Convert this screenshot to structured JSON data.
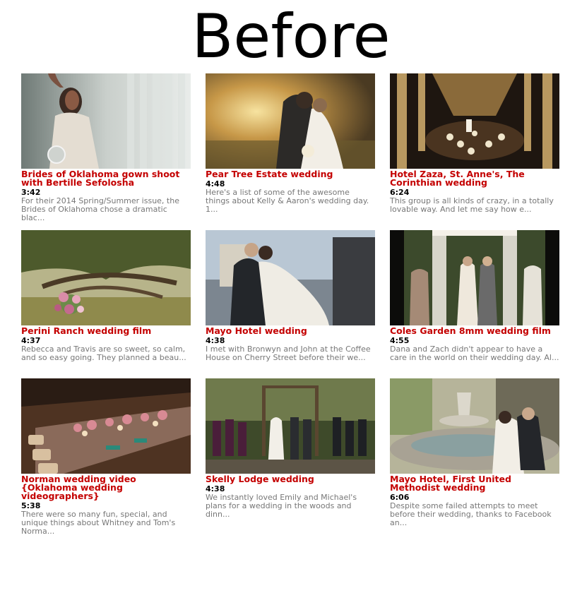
{
  "heading": "Before",
  "videos": [
    {
      "title": "Brides of Oklahoma gown shoot with Bertille Sefolosha",
      "duration": "3:42",
      "description": "For their 2014 Spring/Summer issue, the Brides of Oklahoma chose a dramatic blac..."
    },
    {
      "title": "Pear Tree Estate wedding",
      "duration": "4:48",
      "description": "Here's a list of some of the awesome things about Kelly & Aaron's wedding day. 1..."
    },
    {
      "title": "Hotel Zaza, St. Anne's, The Corinthian wedding",
      "duration": "6:24",
      "description": "This group is all kinds of crazy, in a totally lovable way. And let me say how e..."
    },
    {
      "title": "Perini Ranch wedding film",
      "duration": "4:37",
      "description": "Rebecca and Travis are so sweet, so calm, and so easy going. They planned a beau..."
    },
    {
      "title": "Mayo Hotel wedding",
      "duration": "4:38",
      "description": "I met with Bronwyn and John at the Coffee House on Cherry Street before their we..."
    },
    {
      "title": "Coles Garden 8mm wedding film",
      "duration": "4:55",
      "description": "Dana and Zach didn't appear to have a care in the world on their wedding day. Al..."
    },
    {
      "title": "Norman wedding video {Oklahoma wedding videographers}",
      "duration": "5:38",
      "description": "There were so many fun, special, and unique things about Whitney and Tom's Norma..."
    },
    {
      "title": "Skelly Lodge wedding",
      "duration": "4:38",
      "description": "We instantly loved Emily and Michael's plans for a wedding in the woods and dinn..."
    },
    {
      "title": "Mayo Hotel, First United Methodist wedding",
      "duration": "6:06",
      "description": "Despite some failed attempts to meet before their wedding, thanks to Facebook an..."
    }
  ]
}
